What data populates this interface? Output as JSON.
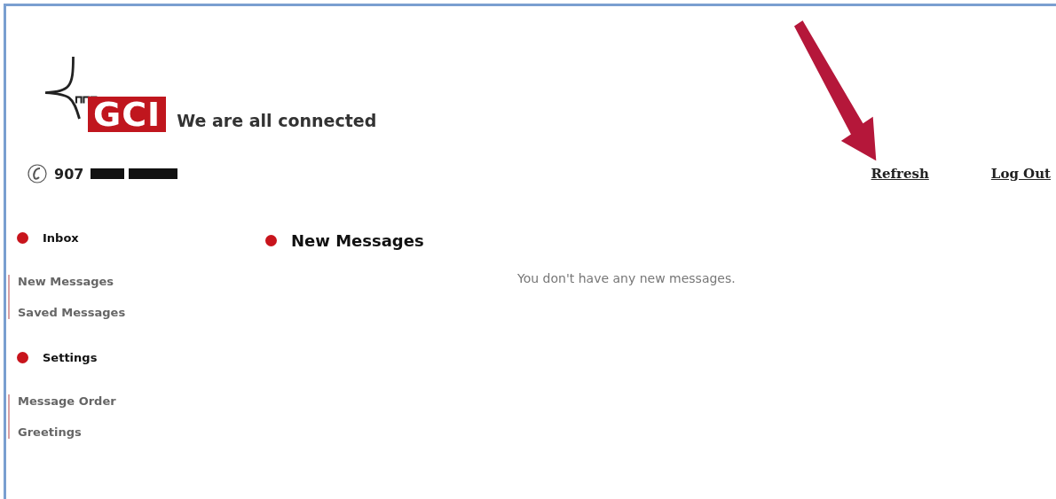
{
  "header": {
    "logo": "GCI",
    "tagline": "We are all connected",
    "phone": "907"
  },
  "top_links": [
    {
      "label": "Refresh"
    },
    {
      "label": "Log Out"
    }
  ],
  "sidebar": [
    {
      "heading": "Inbox",
      "items": [
        {
          "label": "New Messages"
        },
        {
          "label": "Saved Messages"
        }
      ]
    },
    {
      "heading": "Settings",
      "items": [
        {
          "label": "Message Order"
        },
        {
          "label": "Greetings"
        }
      ]
    }
  ],
  "main": {
    "heading": "New Messages",
    "message": "You don't have any new messages."
  }
}
